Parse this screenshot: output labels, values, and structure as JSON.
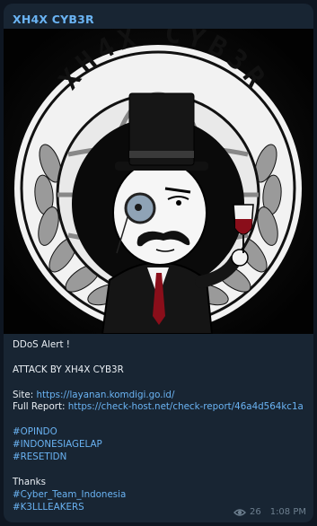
{
  "channel": {
    "name": "XH4X CYB3R"
  },
  "image": {
    "logo_text": "XH4X CYB3R"
  },
  "caption": {
    "alert": "DDoS Alert !",
    "attack": "ATTACK BY XH4X CYB3R",
    "site_label": "Site:",
    "site_url": "https://layanan.komdigi.go.id/",
    "report_label": "Full Report:",
    "report_url": "https://check-host.net/check-report/46a4d564kc1a",
    "hashtags": [
      "#OPINDO",
      "#INDONESIAGELAP",
      "#RESETIDN"
    ],
    "thanks": "Thanks",
    "credits": [
      "#Cyber_Team_Indonesia",
      "#K3LLLEAKERS"
    ]
  },
  "meta": {
    "views": "26",
    "time": "1:08 PM"
  },
  "colors": {
    "accent": "#6ab3f3",
    "bubble": "#182533",
    "background": "#0e1621",
    "meta": "#6d7f8f"
  }
}
